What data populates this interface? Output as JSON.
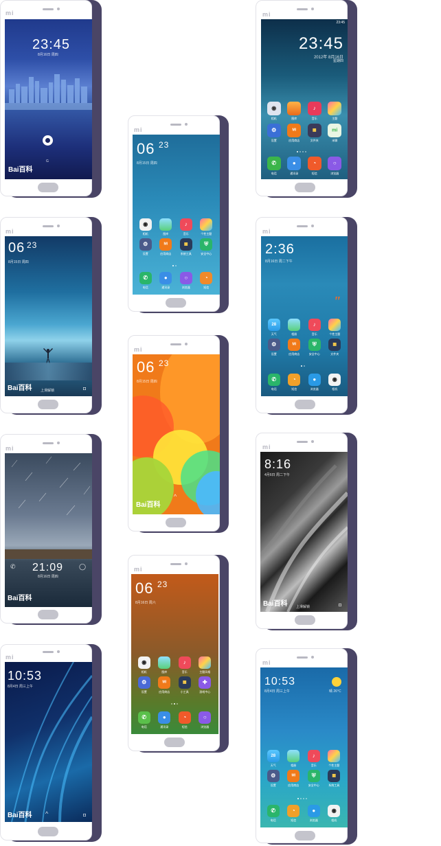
{
  "brand": {
    "logo_text": "mi",
    "watermark": "Bai百科"
  },
  "phones": {
    "p1": {
      "time": "23:45",
      "date": "8月16日 周四"
    },
    "p2": {
      "time": "23:45",
      "date_line1": "2012年 8月16日",
      "date_line2": "星期四",
      "status_time": "23:45",
      "apps": [
        "相机",
        "图库",
        "音乐",
        "主题",
        "设置",
        "应用商店",
        "文件夹",
        "米聊"
      ],
      "dock": [
        "电话",
        "通讯录",
        "短信",
        "浏览器"
      ]
    },
    "p3": {
      "time_h": "06",
      "time_m": "23",
      "date": "8月15日 周四",
      "apps": [
        "相机",
        "图库",
        "音乐",
        "个性主题",
        "设置",
        "应用商店",
        "系统工具",
        "安全中心"
      ],
      "dock": [
        "电话",
        "通讯录",
        "浏览器",
        "短信"
      ]
    },
    "p4": {
      "time_h": "06",
      "time_m": "23",
      "date": "8月15日 周四",
      "hint": "上滑解锁"
    },
    "p5": {
      "time": "2:36",
      "date": "8月16日 周二下午",
      "apps": [
        "天气",
        "相册",
        "音乐",
        "个性主题",
        "设置",
        "应用商店",
        "安全中心",
        "文件夹"
      ],
      "dock": [
        "电话",
        "短信",
        "浏览器",
        "相机"
      ],
      "weather_value": "28"
    },
    "p6": {
      "time_h": "06",
      "time_m": "23",
      "date": "8月15日 周四"
    },
    "p7": {
      "time": "8:16",
      "date": "4月6日 周二下午",
      "hint": "上滑解锁"
    },
    "p8": {
      "time": "21:09",
      "date": "8月16日 周四"
    },
    "p9": {
      "time_h": "06",
      "time_m": "23",
      "date": "8月16日 周六",
      "apps": [
        "相机",
        "图库",
        "音乐",
        "主题风格",
        "设置",
        "应用商店",
        "小工具",
        "游戏中心"
      ],
      "dock": [
        "电话",
        "通讯录",
        "短信",
        "浏览器"
      ]
    },
    "p10": {
      "time": "10:53",
      "date": "8月4日 周三上午"
    },
    "p11": {
      "time": "10:53",
      "date": "8月4日 周三上午",
      "temp": "晴 26°C",
      "weather_value": "28",
      "apps": [
        "天气",
        "相册",
        "音乐",
        "个性主题",
        "设置",
        "应用商店",
        "安全中心",
        "系统工具"
      ],
      "dock": [
        "电话",
        "短信",
        "浏览器",
        "相机"
      ]
    }
  },
  "colors": {
    "shadow": "#4a4566",
    "frame": "#ffffff"
  }
}
